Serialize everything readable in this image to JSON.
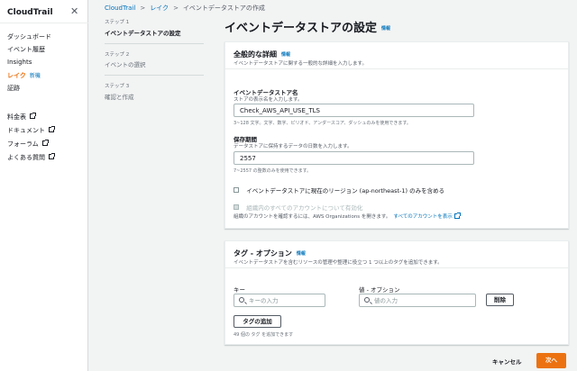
{
  "sidebar": {
    "title": "CloudTrail",
    "items": [
      {
        "label": "ダッシュボード"
      },
      {
        "label": "イベント履歴"
      },
      {
        "label": "Insights"
      },
      {
        "label": "レイク",
        "badge": "新機"
      },
      {
        "label": "証跡"
      }
    ],
    "links": [
      {
        "label": "料金表"
      },
      {
        "label": "ドキュメント"
      },
      {
        "label": "フォーラム"
      },
      {
        "label": "よくある質問"
      }
    ]
  },
  "breadcrumb": {
    "items": [
      "CloudTrail",
      "レイク",
      "イベントデータストアの作成"
    ]
  },
  "steps": [
    {
      "label": "ステップ 1",
      "name": "イベントデータストアの設定"
    },
    {
      "label": "ステップ 2",
      "name": "イベントの選択"
    },
    {
      "label": "ステップ 3",
      "name": "確認と作成"
    }
  ],
  "page": {
    "title": "イベントデータストアの設定",
    "info": "情報"
  },
  "general": {
    "title": "全般的な詳細",
    "info": "情報",
    "description": "イベントデータストアに関する一般的な詳細を入力します。",
    "name_label": "イベントデータストア名",
    "name_desc": "ストアの表示名を入力します。",
    "name_value": "Check_AWS_API_USE_TLS",
    "name_hint": "3~128 文字。文字、数字、ピリオド、アンダースコア、ダッシュのみを使用できます。",
    "retention_label": "保存期間",
    "retention_desc": "データストアに保持するデータの日数を入力します。",
    "retention_value": "2557",
    "retention_hint": "7~2557 の整数のみを使用できます。",
    "region_checkbox": "イベントデータストアに現在のリージョン (ap-northeast-1) のみを含める",
    "org_checkbox": "組織内のすべてのアカウントについて有効化",
    "org_desc": "組織のアカウントを確認するには、AWS Organizations を開きます。",
    "org_link": "すべてのアカウントを表示"
  },
  "tags": {
    "title": "タグ - オプション",
    "info": "情報",
    "description": "イベントデータストアを含むリソースの管理や整理に役立つ 1 つ以上のタグを追加できます。",
    "key_label": "キー",
    "key_placeholder": "キーの入力",
    "value_label": "値 - オプション",
    "value_placeholder": "値の入力",
    "remove_label": "削除",
    "add_label": "タグの追加",
    "remaining": "49 個の タグ を追加できます"
  },
  "footer": {
    "cancel": "キャンセル",
    "next": "次へ"
  },
  "colors": {
    "accent": "#ec7211",
    "link": "#0073bb"
  }
}
